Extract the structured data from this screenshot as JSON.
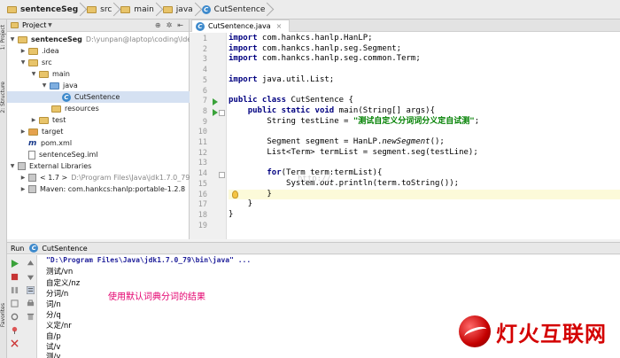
{
  "breadcrumb": [
    "sentenceSeg",
    "src",
    "main",
    "java",
    "CutSentence"
  ],
  "project_panel": {
    "title": "Project",
    "tree": [
      {
        "label": "sentenceSeg",
        "path": "D:\\yunpan@laptop\\coding\\IdeaPro",
        "expanded": true
      },
      {
        "label": ".idea",
        "expanded": false
      },
      {
        "label": "src",
        "expanded": true
      },
      {
        "label": "main",
        "expanded": true
      },
      {
        "label": "java",
        "expanded": true
      },
      {
        "label": "CutSentence",
        "selected": true
      },
      {
        "label": "resources"
      },
      {
        "label": "test",
        "expanded": false
      },
      {
        "label": "target",
        "expanded": false
      },
      {
        "label": "pom.xml"
      },
      {
        "label": "sentenceSeg.iml"
      },
      {
        "label": "External Libraries",
        "expanded": true
      },
      {
        "label": "< 1.7 >",
        "path": "D:\\Program Files\\Java\\jdk1.7.0_79"
      },
      {
        "label": "Maven: com.hankcs:hanlp:portable-1.2.8"
      }
    ]
  },
  "left_strip": [
    "1: Project",
    "2: Structure",
    "Favorites"
  ],
  "editor": {
    "tab": "CutSentence.java",
    "watermark": "http://",
    "lines": [
      {
        "n": "1",
        "t": "import com.hankcs.hanlp.HanLP;"
      },
      {
        "n": "2",
        "t": "import com.hankcs.hanlp.seg.Segment;"
      },
      {
        "n": "3",
        "t": "import com.hankcs.hanlp.seg.common.Term;"
      },
      {
        "n": "4",
        "t": ""
      },
      {
        "n": "5",
        "t": "import java.util.List;"
      },
      {
        "n": "6",
        "t": ""
      },
      {
        "n": "7",
        "t": "public class CutSentence {"
      },
      {
        "n": "8",
        "t": "    public static void main(String[] args){"
      },
      {
        "n": "9",
        "t": "        String testLine = \"测试自定义分词词分义定自试测\";"
      },
      {
        "n": "10",
        "t": ""
      },
      {
        "n": "11",
        "t": "        Segment segment = HanLP.newSegment();"
      },
      {
        "n": "12",
        "t": "        List<Term> termList = segment.seg(testLine);"
      },
      {
        "n": "13",
        "t": ""
      },
      {
        "n": "14",
        "t": "        for(Term term:termList){"
      },
      {
        "n": "15",
        "t": "            System.out.println(term.toString());"
      },
      {
        "n": "16",
        "t": "        }"
      },
      {
        "n": "17",
        "t": "    }"
      },
      {
        "n": "18",
        "t": "}"
      },
      {
        "n": "19",
        "t": ""
      }
    ]
  },
  "run_panel": {
    "label": "Run",
    "config": "CutSentence",
    "command": "\"D:\\Program Files\\Java\\jdk1.7.0_79\\bin\\java\" ...",
    "output": [
      "测试/vn",
      "自定义/nz",
      "分词/n",
      "词/n",
      "分/q",
      "义定/nr",
      "自/p",
      "试/v",
      "测/v"
    ],
    "note": "使用默认词典分词的结果"
  },
  "logo_text": "灯火互联网"
}
